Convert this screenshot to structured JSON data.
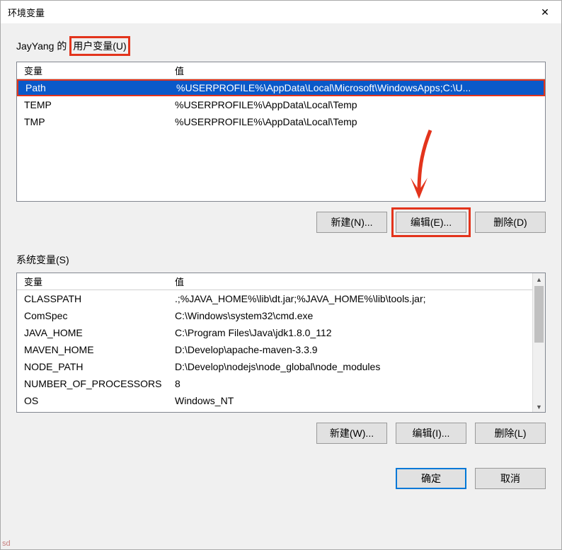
{
  "window": {
    "title": "环境变量",
    "close_label": "✕"
  },
  "user_section": {
    "prefix": "JayYang 的",
    "label": "用户变量(U)",
    "header_var": "变量",
    "header_val": "值",
    "rows": [
      {
        "var": "Path",
        "val": "%USERPROFILE%\\AppData\\Local\\Microsoft\\WindowsApps;C:\\U..."
      },
      {
        "var": "TEMP",
        "val": "%USERPROFILE%\\AppData\\Local\\Temp"
      },
      {
        "var": "TMP",
        "val": "%USERPROFILE%\\AppData\\Local\\Temp"
      }
    ],
    "buttons": {
      "new": "新建(N)...",
      "edit": "编辑(E)...",
      "delete": "删除(D)"
    }
  },
  "system_section": {
    "label": "系统变量(S)",
    "header_var": "变量",
    "header_val": "值",
    "rows": [
      {
        "var": "CLASSPATH",
        "val": ".;%JAVA_HOME%\\lib\\dt.jar;%JAVA_HOME%\\lib\\tools.jar;"
      },
      {
        "var": "ComSpec",
        "val": "C:\\Windows\\system32\\cmd.exe"
      },
      {
        "var": "JAVA_HOME",
        "val": "C:\\Program Files\\Java\\jdk1.8.0_112"
      },
      {
        "var": "MAVEN_HOME",
        "val": "D:\\Develop\\apache-maven-3.3.9"
      },
      {
        "var": "NODE_PATH",
        "val": "D:\\Develop\\nodejs\\node_global\\node_modules"
      },
      {
        "var": "NUMBER_OF_PROCESSORS",
        "val": "8"
      },
      {
        "var": "OS",
        "val": "Windows_NT"
      }
    ],
    "buttons": {
      "new": "新建(W)...",
      "edit": "编辑(I)...",
      "delete": "删除(L)"
    }
  },
  "footer": {
    "ok": "确定",
    "cancel": "取消"
  },
  "corner": "sd"
}
